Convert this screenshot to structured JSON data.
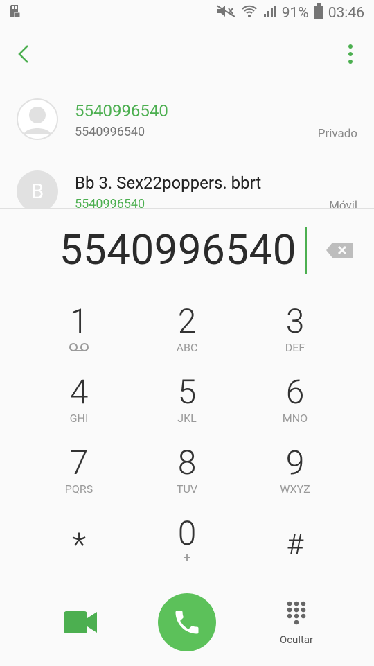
{
  "status": {
    "battery": "91%",
    "time": "03:46"
  },
  "colors": {
    "accent": "#4caf50",
    "call_button": "#5cc15a"
  },
  "icons": {
    "back": "chevron-left",
    "more": "vertical-dots",
    "backspace": "backspace",
    "voicemail": "voicemail",
    "video": "video-camera",
    "call": "phone-handset",
    "hide": "keypad-grid"
  },
  "suggestions": [
    {
      "name": "5540996540",
      "number": "5540996540",
      "type": "Privado",
      "avatar": ""
    },
    {
      "name": "Bb 3. Sex22poppers. bbrt",
      "number": "5540996540",
      "type": "Móvil",
      "avatar": "B"
    }
  ],
  "dialer": {
    "number": "5540996540"
  },
  "keys": [
    {
      "digit": "1",
      "letters": ""
    },
    {
      "digit": "2",
      "letters": "ABC"
    },
    {
      "digit": "3",
      "letters": "DEF"
    },
    {
      "digit": "4",
      "letters": "GHI"
    },
    {
      "digit": "5",
      "letters": "JKL"
    },
    {
      "digit": "6",
      "letters": "MNO"
    },
    {
      "digit": "7",
      "letters": "PQRS"
    },
    {
      "digit": "8",
      "letters": "TUV"
    },
    {
      "digit": "9",
      "letters": "WXYZ"
    },
    {
      "digit": "*",
      "letters": ""
    },
    {
      "digit": "0",
      "letters": "+"
    },
    {
      "digit": "#",
      "letters": ""
    }
  ],
  "bottom": {
    "hide_label": "Ocultar"
  }
}
